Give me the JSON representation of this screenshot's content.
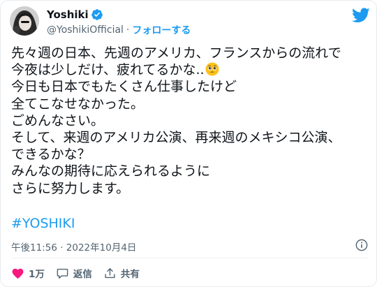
{
  "tweet": {
    "author": {
      "display_name": "Yoshiki",
      "handle": "@YoshikiOfficial",
      "separator": "·",
      "follow_label": "フォローする"
    },
    "body_lines": [
      "先々週の日本、先週のアメリカ、フランスからの流れで",
      "今夜は少しだけ、疲れてるかな..",
      "今日も日本でもたくさん仕事したけど",
      "全てこなせなかった。",
      "ごめんなさい。",
      "そして、来週のアメリカ公演、再来週のメキシコ公演、",
      "できるかな？",
      "みんなの期待に応えられるように",
      "さらに努力します。"
    ],
    "emoji_icon": "pleading-face-emoji",
    "hashtag": "#YOSHIKI",
    "timestamp": "午後11:56 · 2022年10月4日",
    "actions": {
      "like_count": "1万",
      "reply_label": "返信",
      "share_label": "共有"
    }
  },
  "icons": {
    "brand": "twitter-bird-icon",
    "verified": "verified-badge-icon",
    "info": "info-icon",
    "like": "heart-icon",
    "reply": "speech-bubble-icon",
    "share": "share-icon"
  },
  "colors": {
    "accent": "#1d9bf0",
    "like_red": "#f91880",
    "text": "#0f1419",
    "secondary": "#536471"
  }
}
